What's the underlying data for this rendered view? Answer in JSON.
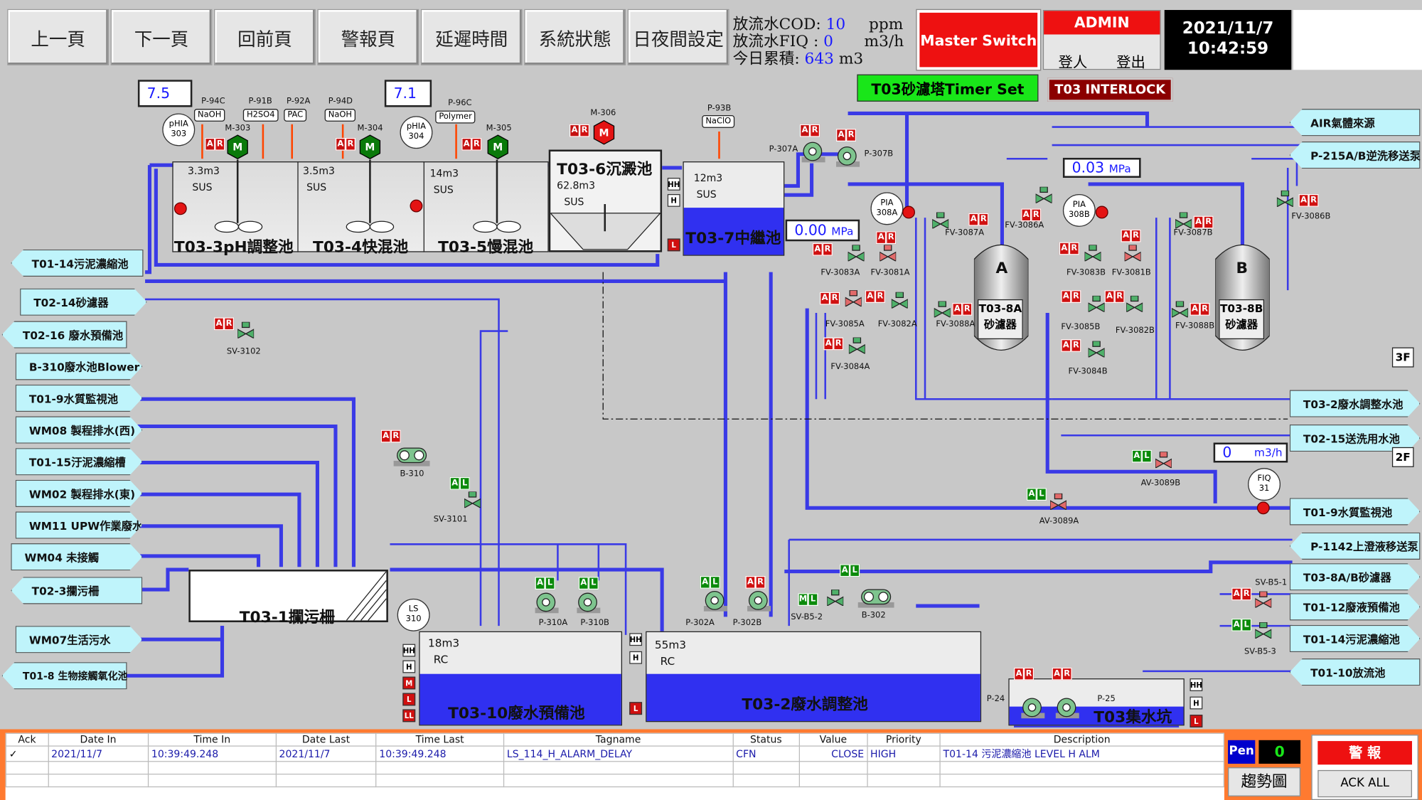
{
  "nav": {
    "prev": "上一頁",
    "next": "下一頁",
    "back": "回前頁",
    "alarm": "警報頁",
    "delay": "延遲時間",
    "system": "系統狀態",
    "daynight": "日夜間設定"
  },
  "discharge": {
    "cod_label": "放流水COD:",
    "cod_value": "10",
    "cod_unit": "ppm",
    "fiq_label": "放流水FIQ :",
    "fiq_value": "0",
    "fiq_unit": "m3/h",
    "today_label": "今日累積:",
    "today_value": "643",
    "today_unit": "m3"
  },
  "master_switch": "Master Switch",
  "admin": {
    "title": "ADMIN",
    "login": "登人",
    "logout": "登出"
  },
  "clock": {
    "date": "2021/11/7",
    "time": "10:42:59"
  },
  "t03_timer": "T03砂濾塔Timer Set",
  "t03_interlock": "T03 INTERLOCK",
  "ph303": "7.5",
  "ph304": "7.1",
  "chemicals": {
    "p94c": "P-94C",
    "naoh1": "NaOH",
    "p91b": "P-91B",
    "h2so4": "H2SO4",
    "p92a": "P-92A",
    "pac": "PAC",
    "p94d": "P-94D",
    "naoh2": "NaOH",
    "p96c": "P-96C",
    "polymer": "Polymer",
    "p93b": "P-93B",
    "naclo": "NaClO"
  },
  "motors": {
    "m303": "M-303",
    "m304": "M-304",
    "m305": "M-305",
    "m306": "M-306"
  },
  "meters": {
    "phia303": "pHIA\n303",
    "phia304": "pHIA\n304",
    "pia308a": "PIA\n308A",
    "pia308b": "PIA\n308B",
    "ls310": "LS\n310",
    "fiq31": "FIQ\n31"
  },
  "tanks": {
    "t03_3": {
      "vol": "3.3m3",
      "mat": "SUS",
      "name": "T03-3pH調整池"
    },
    "t03_4": {
      "vol": "3.5m3",
      "mat": "SUS",
      "name": "T03-4快混池"
    },
    "t03_5": {
      "vol": "14m3",
      "mat": "SUS",
      "name": "T03-5慢混池"
    },
    "t03_6": {
      "vol": "62.8m3",
      "mat": "SUS",
      "name": "T03-6沉澱池"
    },
    "t03_7": {
      "vol": "12m3",
      "mat": "SUS",
      "name": "T03-7中繼池"
    },
    "t03_1": {
      "name": "T03-1攔污柵"
    },
    "t03_10": {
      "vol": "18m3",
      "mat": "RC",
      "name": "T03-10廢水預備池"
    },
    "t03_2": {
      "vol": "55m3",
      "mat": "RC",
      "name": "T03-2廢水調整池"
    },
    "t03_pit": {
      "name": "T03集水坑"
    },
    "filter_a": {
      "letter": "A",
      "name": "T03-8A\n砂濾器"
    },
    "filter_b": {
      "letter": "B",
      "name": "T03-8B\n砂濾器"
    }
  },
  "pressure": {
    "value1": "0.00",
    "unit1": "MPa",
    "value2": "0.03",
    "unit2": "MPa"
  },
  "flow": {
    "value": "0",
    "unit": "m3/h"
  },
  "floors": {
    "f3": "3F",
    "f2": "2F"
  },
  "left_links": [
    "T01-14污泥濃縮池",
    "T02-14砂濾器",
    "T02-16 廢水預備池",
    "B-310廢水池Blower",
    "T01-9水質監視池",
    "WM08 製程排水(西)",
    "T01-15汙泥濃縮槽",
    "WM02 製程排水(東)",
    "WM11 UPW作業廢水",
    "WM04 未接觸",
    "T02-3攔污柵",
    "WM07生活污水",
    "T01-8 生物接觸氧化池"
  ],
  "right_links": [
    "AIR氣體來源",
    "P-215A/B逆洗移送泵",
    "T03-2廢水調整水池",
    "T02-15送洗用水池",
    "T01-9水質監視池",
    "P-1142上澄液移送泵",
    "T03-8A/B砂濾器",
    "T01-12廢液預備池",
    "T01-14污泥濃縮池",
    "T01-10放流池"
  ],
  "equip": {
    "p307a": "P-307A",
    "p307b": "P-307B",
    "sv3102": "SV-3102",
    "b310": "B-310",
    "sv3101": "SV-3101",
    "p310a": "P-310A",
    "p310b": "P-310B",
    "p302a": "P-302A",
    "p302b": "P-302B",
    "svb52": "SV-B5-2",
    "b302": "B-302",
    "p24": "P-24",
    "p25": "P-25",
    "svb51": "SV-B5-1",
    "svb53": "SV-B5-3",
    "av3089a": "AV-3089A",
    "av3089b": "AV-3089B",
    "fv3083a": "FV-3083A",
    "fv3081a": "FV-3081A",
    "fv3085a": "FV-3085A",
    "fv3082a": "FV-3082A",
    "fv3084a": "FV-3084A",
    "fv3087a": "FV-3087A",
    "fv3086a": "FV-3086A",
    "fv3088a": "FV-3088A",
    "fv3083b": "FV-3083B",
    "fv3081b": "FV-3081B",
    "fv3085b": "FV-3085B",
    "fv3082b": "FV-3082B",
    "fv3084b": "FV-3084B",
    "fv3087b": "FV-3087B",
    "fv3086b": "FV-3086B",
    "fv3088b": "FV-3088B"
  },
  "alarm_table": {
    "headers": [
      "Ack",
      "Date In",
      "Time In",
      "Date Last",
      "Time Last",
      "Tagname",
      "Status",
      "Value",
      "Priority",
      "Description"
    ],
    "row": {
      "ack": "✓",
      "date_in": "2021/11/7",
      "time_in": "10:39:49.248",
      "date_last": "2021/11/7",
      "time_last": "10:39:49.248",
      "tagname": "LS_114_H_ALARM_DELAY",
      "status": "CFN",
      "value": "CLOSE",
      "priority": "HIGH",
      "description": "T01-14 污泥濃縮池 LEVEL H ALM"
    }
  },
  "pen": {
    "label": "Pen",
    "value": "0",
    "trend": "趨勢圖"
  },
  "alarm_panel": {
    "title": "警 報",
    "ack_all": "ACK ALL"
  },
  "colors": {
    "pipe": "#3a3ae6",
    "cyan": "#bff4fb",
    "red": "#e41414",
    "green": "#19e619",
    "water": "#3030f0"
  }
}
